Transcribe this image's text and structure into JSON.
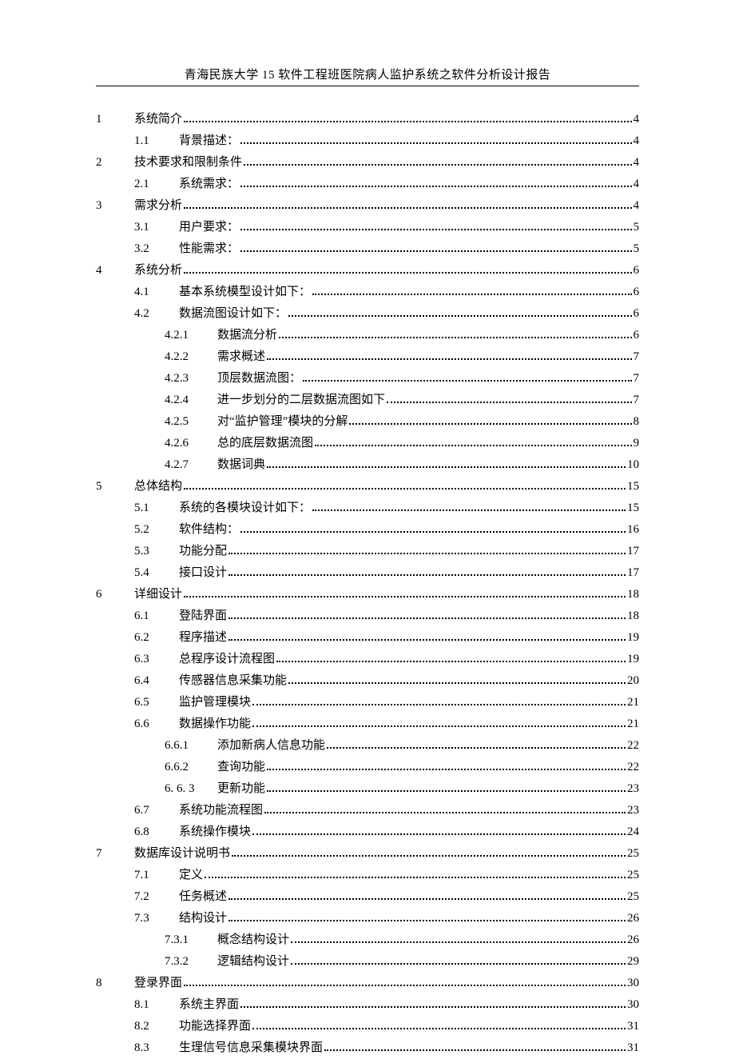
{
  "header": "青海民族大学 15 软件工程班医院病人监护系统之软件分析设计报告",
  "toc": [
    {
      "level": 1,
      "num": "1",
      "title": "系统简介",
      "page": "4"
    },
    {
      "level": 2,
      "num": "1.1",
      "title": "背景描述：",
      "page": "4"
    },
    {
      "level": 1,
      "num": "2",
      "title": "技术要求和限制条件",
      "page": "4"
    },
    {
      "level": 2,
      "num": "2.1",
      "title": "系统需求：",
      "page": "4"
    },
    {
      "level": 1,
      "num": "3",
      "title": "需求分析",
      "page": "4"
    },
    {
      "level": 2,
      "num": "3.1",
      "title": "用户要求：",
      "page": "5"
    },
    {
      "level": 2,
      "num": "3.2",
      "title": "性能需求：",
      "page": "5"
    },
    {
      "level": 1,
      "num": "4",
      "title": "系统分析",
      "page": "6"
    },
    {
      "level": 2,
      "num": "4.1",
      "title": "基本系统模型设计如下：",
      "page": "6"
    },
    {
      "level": 2,
      "num": "4.2",
      "title": "数据流图设计如下：",
      "page": "6"
    },
    {
      "level": 3,
      "num": "4.2.1",
      "title": "数据流分析",
      "page": "6"
    },
    {
      "level": 3,
      "num": "4.2.2",
      "title": "需求概述",
      "page": "7"
    },
    {
      "level": 3,
      "num": "4.2.3",
      "title": "顶层数据流图：",
      "page": "7"
    },
    {
      "level": 3,
      "num": "4.2.4",
      "title": "进一步划分的二层数据流图如下",
      "page": "7"
    },
    {
      "level": 3,
      "num": "4.2.5",
      "title": "对“监护管理”模块的分解",
      "page": "8"
    },
    {
      "level": 3,
      "num": "4.2.6",
      "title": "总的底层数据流图",
      "page": "9"
    },
    {
      "level": 3,
      "num": "4.2.7",
      "title": "数据词典",
      "page": "10"
    },
    {
      "level": 1,
      "num": "5",
      "title": "总体结构",
      "page": "15"
    },
    {
      "level": 2,
      "num": "5.1",
      "title": "系统的各模块设计如下：",
      "page": "15"
    },
    {
      "level": 2,
      "num": "5.2",
      "title": "软件结构：",
      "page": "16"
    },
    {
      "level": 2,
      "num": "5.3",
      "title": "功能分配",
      "page": "17"
    },
    {
      "level": 2,
      "num": "5.4",
      "title": "接口设计",
      "page": "17"
    },
    {
      "level": 1,
      "num": "6",
      "title": "详细设计",
      "page": "18"
    },
    {
      "level": 2,
      "num": "6.1",
      "title": "登陆界面",
      "page": "18"
    },
    {
      "level": 2,
      "num": "6.2",
      "title": "程序描述",
      "page": "19"
    },
    {
      "level": 2,
      "num": "6.3",
      "title": "总程序设计流程图",
      "page": "19"
    },
    {
      "level": 2,
      "num": "6.4",
      "title": "传感器信息采集功能",
      "page": "20"
    },
    {
      "level": 2,
      "num": "6.5",
      "title": "监护管理模块",
      "page": "21"
    },
    {
      "level": 2,
      "num": "6.6",
      "title": "数据操作功能",
      "page": "21"
    },
    {
      "level": 3,
      "num": "6.6.1",
      "title": "添加新病人信息功能",
      "page": "22"
    },
    {
      "level": 3,
      "num": "6.6.2",
      "title": "查询功能",
      "page": "22"
    },
    {
      "level": 3,
      "num": "6. 6. 3",
      "title": "更新功能",
      "page": "23"
    },
    {
      "level": 2,
      "num": "6.7",
      "title": "系统功能流程图",
      "page": "23"
    },
    {
      "level": 2,
      "num": "6.8",
      "title": "系统操作模块",
      "page": "24"
    },
    {
      "level": 1,
      "num": "7",
      "title": "数据库设计说明书",
      "page": "25"
    },
    {
      "level": 2,
      "num": "7.1",
      "title": "定义",
      "page": "25"
    },
    {
      "level": 2,
      "num": "7.2",
      "title": "任务概述",
      "page": "25"
    },
    {
      "level": 2,
      "num": "7.3",
      "title": "结构设计",
      "page": "26"
    },
    {
      "level": 3,
      "num": "7.3.1",
      "title": "概念结构设计",
      "page": "26"
    },
    {
      "level": 3,
      "num": "7.3.2",
      "title": "逻辑结构设计",
      "page": "29"
    },
    {
      "level": 1,
      "num": "8",
      "title": "登录界面",
      "page": "30"
    },
    {
      "level": 2,
      "num": "8.1",
      "title": "系统主界面",
      "page": "30"
    },
    {
      "level": 2,
      "num": "8.2",
      "title": "功能选择界面",
      "page": "31"
    },
    {
      "level": 2,
      "num": "8.3",
      "title": "生理信号信息采集模块界面",
      "page": "31"
    }
  ]
}
